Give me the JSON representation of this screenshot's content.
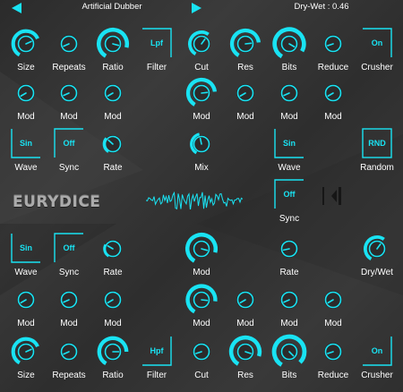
{
  "app": {
    "logo_text": "EURYDICE"
  },
  "topbar": {
    "preset_name": "Artificial Dubber",
    "dry_wet_readout": "Dry-Wet : 0.46"
  },
  "colors": {
    "accent": "#19e3f3",
    "knob_body": "#2b2b2b",
    "panel_bg": "#353535",
    "text": "#ffffff"
  },
  "icons": {
    "prev_preset": "triangle-left-icon",
    "next_preset": "triangle-right-icon",
    "collapse": "collapse-panel-icon",
    "waveform": "waveform-display-icon"
  },
  "labels": {
    "size": "Size",
    "repeats": "Repeats",
    "ratio": "Ratio",
    "filter": "Filter",
    "cut": "Cut",
    "res": "Res",
    "bits": "Bits",
    "reduce": "Reduce",
    "crusher": "Crusher",
    "mod": "Mod",
    "wave": "Wave",
    "sync": "Sync",
    "rate": "Rate",
    "mix": "Mix",
    "random": "Random",
    "dry_wet": "Dry/Wet"
  },
  "buttons": {
    "filter_top": "Lpf",
    "crusher_top": "On",
    "wave_top_left": "Sin",
    "sync_top_left": "Off",
    "wave_top_right": "Sin",
    "random": "RND",
    "sync_middle": "Off",
    "wave_bottom_left": "Sin",
    "sync_bottom_left": "Off",
    "filter_bottom": "Hpf",
    "crusher_bottom": "On"
  },
  "knob_values": {
    "top_size": 0.72,
    "top_repeats": 0.12,
    "top_ratio": 0.85,
    "top_cut": 0.62,
    "top_res": 0.78,
    "top_bits": 0.9,
    "top_reduce": 0.14,
    "top_mod_1": 0.1,
    "top_mod_2": 0.12,
    "top_mod_3": 0.1,
    "top_mod_cut": 0.78,
    "top_mod_res": 0.1,
    "top_mod_bits": 0.12,
    "top_mod_reduce": 0.1,
    "top_lfo_rate": 0.34,
    "mix": 0.46,
    "bottom_lfo_rate": 0.3,
    "bottom_filter_mod": 0.85,
    "bottom_rate_right": 0.16,
    "dry_wet": 0.62,
    "bottom_mod_1": 0.1,
    "bottom_mod_2": 0.12,
    "bottom_mod_3": 0.1,
    "bottom_mod_cut": 0.82,
    "bottom_mod_res": 0.1,
    "bottom_mod_bits": 0.12,
    "bottom_mod_reduce": 0.1,
    "bottom_size": 0.72,
    "bottom_repeats": 0.12,
    "bottom_ratio": 0.8,
    "bottom_cut": 0.14,
    "bottom_res": 0.86,
    "bottom_bits": 0.95,
    "bottom_reduce": 0.14
  }
}
